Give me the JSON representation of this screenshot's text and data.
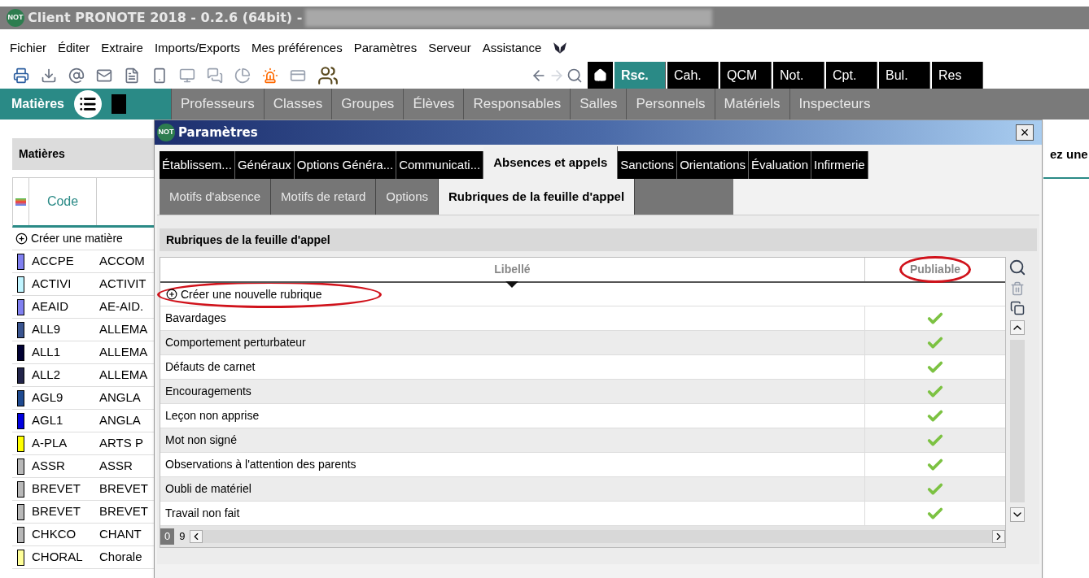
{
  "window": {
    "badge": "NOT",
    "title": "Client PRONOTE 2018 - 0.2.6 (64bit) -"
  },
  "menu": [
    "Fichier",
    "Éditer",
    "Extraire",
    "Imports/Exports",
    "Mes préférences",
    "Paramètres",
    "Serveur",
    "Assistance"
  ],
  "module_tabs": [
    {
      "label": "Rsc.",
      "selected": true
    },
    {
      "label": "Cah.",
      "selected": false
    },
    {
      "label": "QCM",
      "selected": false
    },
    {
      "label": "Not.",
      "selected": false
    },
    {
      "label": "Cpt.",
      "selected": false
    },
    {
      "label": "Bul.",
      "selected": false
    },
    {
      "label": "Res",
      "selected": false
    }
  ],
  "section": {
    "title": "Matières",
    "tabs": [
      {
        "label": "Professeurs",
        "selected": false
      },
      {
        "label": "Classes",
        "selected": false
      },
      {
        "label": "Groupes",
        "selected": false
      },
      {
        "label": "Élèves",
        "selected": false
      },
      {
        "label": "Responsables",
        "selected": false
      },
      {
        "label": "Salles",
        "selected": false
      },
      {
        "label": "Personnels",
        "selected": false
      },
      {
        "label": "Matériels",
        "selected": false
      },
      {
        "label": "Inspecteurs",
        "selected": false
      }
    ]
  },
  "left_panel": {
    "title": "Matières",
    "column": "Code",
    "create": "Créer une matière",
    "rows": [
      {
        "code": "ACCPE",
        "name": "ACCOM",
        "color": "#8080f0"
      },
      {
        "code": "ACTIVI",
        "name": "ACTIVIT",
        "color": "#c0f4ff"
      },
      {
        "code": "AEAID",
        "name": "AE-AID.",
        "color": "#8080f0"
      },
      {
        "code": "ALL9",
        "name": "ALLEMA",
        "color": "#3a5590"
      },
      {
        "code": "ALL1",
        "name": "ALLEMA",
        "color": "#000033"
      },
      {
        "code": "ALL2",
        "name": "ALLEMA",
        "color": "#22244a"
      },
      {
        "code": "AGL9",
        "name": "ANGLA",
        "color": "#1f4a90"
      },
      {
        "code": "AGL1",
        "name": "ANGLA",
        "color": "#0000e0"
      },
      {
        "code": "A-PLA",
        "name": "ARTS P",
        "color": "#ffff00"
      },
      {
        "code": "ASSR",
        "name": "ASSR",
        "color": "#b8b8b8"
      },
      {
        "code": "BREVET",
        "name": "BREVET",
        "color": "#b8b8b8"
      },
      {
        "code": "BREVET",
        "name": "BREVET",
        "color": "#b8b8b8"
      },
      {
        "code": "CHKCO",
        "name": "CHANT",
        "color": "#b8b8b8"
      },
      {
        "code": "CHORAL",
        "name": "Chorale",
        "color": "#ffff99"
      }
    ]
  },
  "behind_text": "ez une",
  "dialog": {
    "badge": "NOT",
    "title": "Paramètres",
    "close": "×",
    "tabs": [
      {
        "label": "Établissem...",
        "selected": false
      },
      {
        "label": "Généraux",
        "selected": false
      },
      {
        "label": "Options Généra...",
        "selected": false
      },
      {
        "label": "Communicati...",
        "selected": false
      },
      {
        "label": "Absences et appels",
        "selected": true
      },
      {
        "label": "Sanctions",
        "selected": false
      },
      {
        "label": "Orientations",
        "selected": false
      },
      {
        "label": "Évaluation",
        "selected": false
      },
      {
        "label": "Infirmerie",
        "selected": false
      }
    ],
    "subtabs": [
      {
        "label": "Motifs d'absence",
        "selected": false
      },
      {
        "label": "Motifs de retard",
        "selected": false
      },
      {
        "label": "Options",
        "selected": false
      },
      {
        "label": "Rubriques de la feuille d'appel",
        "selected": true
      }
    ],
    "panel_title": "Rubriques de la feuille d'appel",
    "columns": [
      "Libellé",
      "Publiable"
    ],
    "create": "Créer une nouvelle rubrique",
    "rows": [
      {
        "label": "Bavardages",
        "publiable": true
      },
      {
        "label": "Comportement perturbateur",
        "publiable": true
      },
      {
        "label": "Défauts de carnet",
        "publiable": true
      },
      {
        "label": "Encouragements",
        "publiable": true
      },
      {
        "label": "Leçon non apprise",
        "publiable": true
      },
      {
        "label": "Mot non signé",
        "publiable": true
      },
      {
        "label": "Observations à l'attention des parents",
        "publiable": true
      },
      {
        "label": "Oubli de matériel",
        "publiable": true
      },
      {
        "label": "Travail non fait",
        "publiable": true
      }
    ],
    "footer": [
      "0",
      "9"
    ]
  }
}
